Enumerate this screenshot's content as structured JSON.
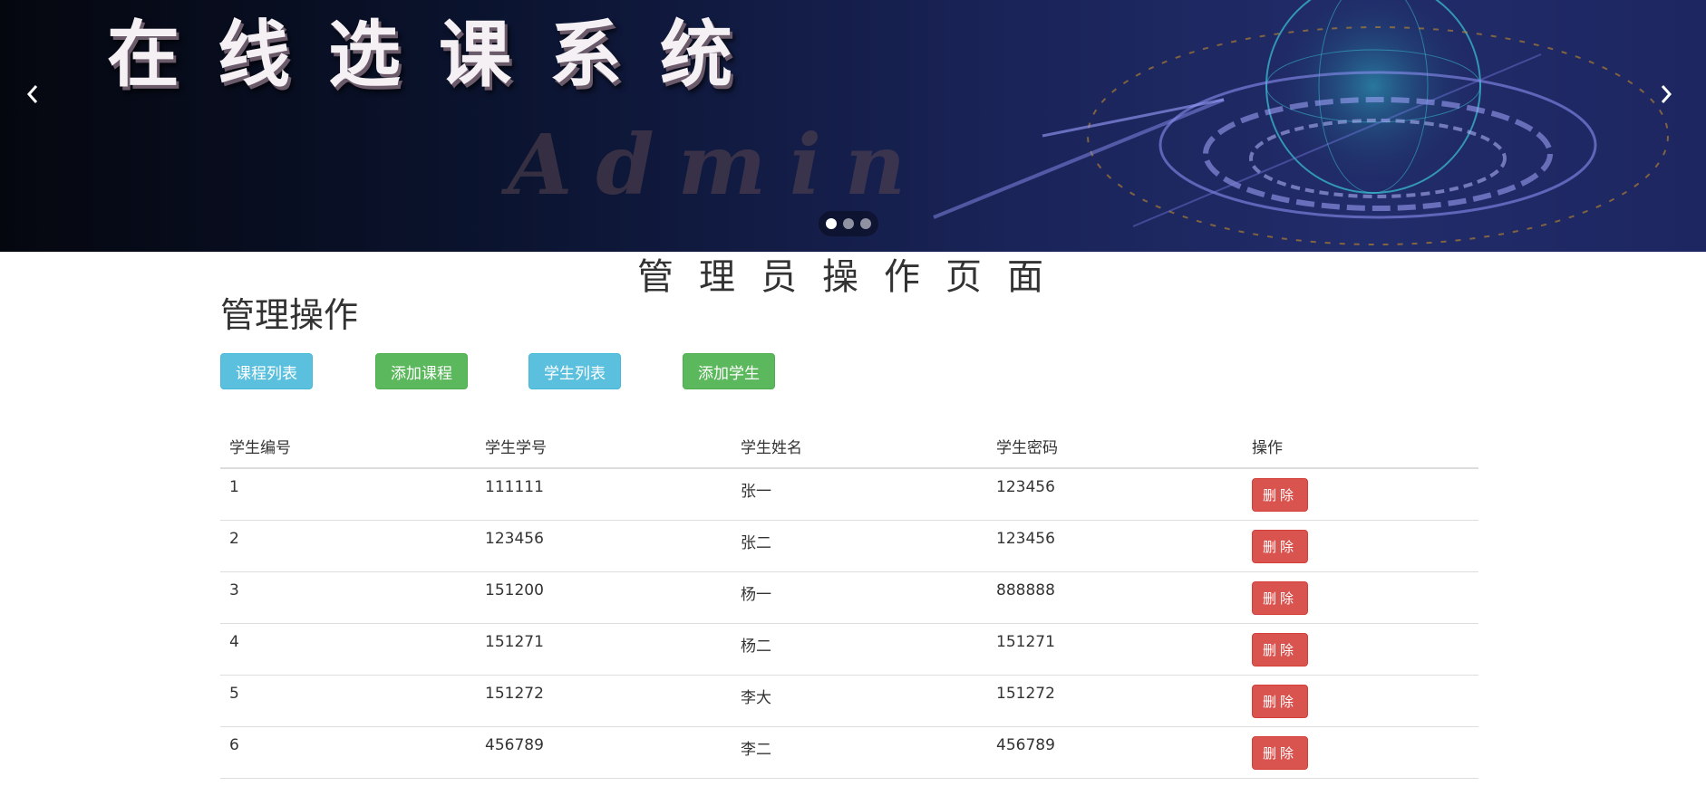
{
  "banner": {
    "title": "在线选课系统",
    "subtitle": "Admin",
    "prev_icon": "chevron-left-icon",
    "next_icon": "chevron-right-icon",
    "slide_count": 3,
    "active_slide": 1
  },
  "page": {
    "heading": "管理员操作页面",
    "section_title": "管理操作"
  },
  "actions": {
    "course_list": "课程列表",
    "add_course": "添加课程",
    "student_list": "学生列表",
    "add_student": "添加学生"
  },
  "table": {
    "headers": [
      "学生编号",
      "学生学号",
      "学生姓名",
      "学生密码",
      "操作"
    ],
    "rows": [
      {
        "id": "1",
        "student_no": "111111",
        "name": "张一",
        "password": "123456",
        "action": "删除"
      },
      {
        "id": "2",
        "student_no": "123456",
        "name": "张二",
        "password": "123456",
        "action": "删除"
      },
      {
        "id": "3",
        "student_no": "151200",
        "name": "杨一",
        "password": "888888",
        "action": "删除"
      },
      {
        "id": "4",
        "student_no": "151271",
        "name": "杨二",
        "password": "151271",
        "action": "删除"
      },
      {
        "id": "5",
        "student_no": "151272",
        "name": "李大",
        "password": "151272",
        "action": "删除"
      },
      {
        "id": "6",
        "student_no": "456789",
        "name": "李二",
        "password": "456789",
        "action": "删除"
      }
    ]
  },
  "colors": {
    "info": "#5bc0de",
    "success": "#5cb85c",
    "danger": "#d9534f",
    "banner_dark": "#0b1430",
    "banner_blue": "#212c6a"
  }
}
